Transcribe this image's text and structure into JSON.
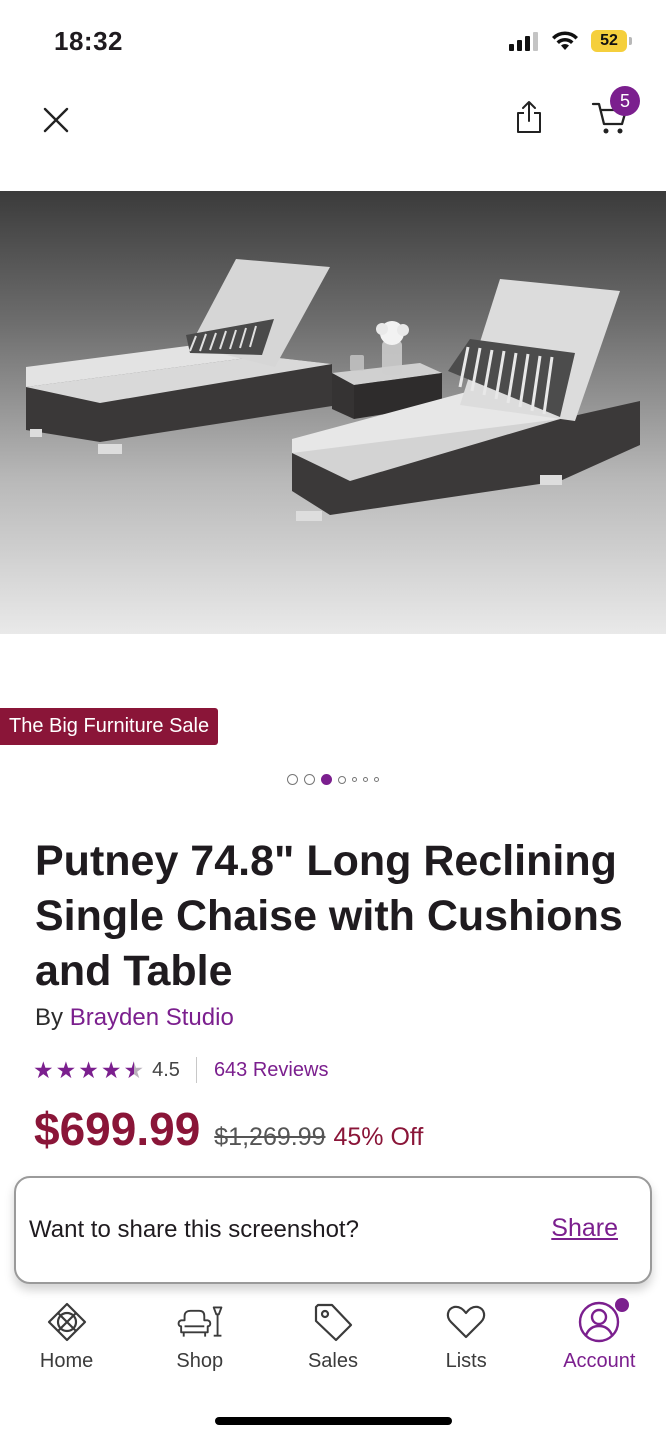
{
  "status_bar": {
    "time": "18:32",
    "battery": "52"
  },
  "header": {
    "cart_count": "5"
  },
  "hero": {
    "icon": "product-image"
  },
  "sale_tag": "The Big Furniture Sale",
  "carousel": {
    "current_index": 3,
    "total": 7
  },
  "product": {
    "title": "Putney 74.8\" Long Reclining Single Chaise with Cushions and Table",
    "by_prefix": "By ",
    "brand": "Brayden Studio",
    "rating": "4.5",
    "rating_value": 4.5,
    "reviews": "643 Reviews",
    "price": "$699.99",
    "original_price": "$1,269.99",
    "discount": "45% Off"
  },
  "share_prompt": {
    "question": "Want to share this screenshot?",
    "action": "Share"
  },
  "bottom_nav": {
    "items": [
      {
        "label": "Home",
        "icon": "home-icon"
      },
      {
        "label": "Shop",
        "icon": "shop-icon"
      },
      {
        "label": "Sales",
        "icon": "tag-icon"
      },
      {
        "label": "Lists",
        "icon": "heart-icon"
      },
      {
        "label": "Account",
        "icon": "account-icon"
      }
    ],
    "active": "Account"
  },
  "colors": {
    "brand": "#7b1f8e",
    "sale": "#8a1538"
  }
}
